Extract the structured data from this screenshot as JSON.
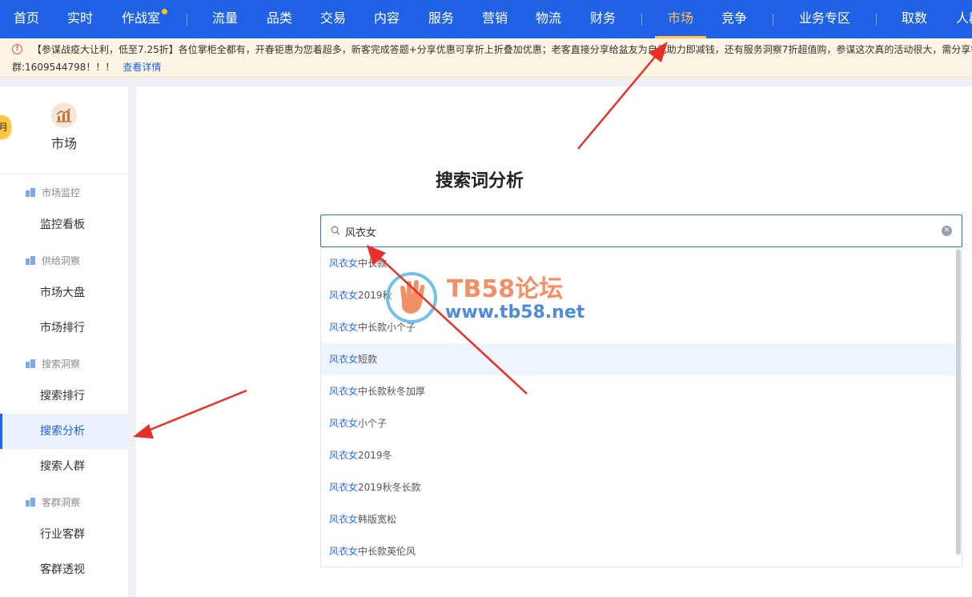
{
  "nav": {
    "items": [
      {
        "label": "首页"
      },
      {
        "label": "实时"
      },
      {
        "label": "作战室"
      },
      {
        "label": "流量"
      },
      {
        "label": "品类"
      },
      {
        "label": "交易"
      },
      {
        "label": "内容"
      },
      {
        "label": "服务"
      },
      {
        "label": "营销"
      },
      {
        "label": "物流"
      },
      {
        "label": "财务"
      },
      {
        "label": "市场"
      },
      {
        "label": "竞争"
      },
      {
        "label": "业务专区"
      },
      {
        "label": "取数"
      },
      {
        "label": "人群"
      }
    ],
    "active": "市场",
    "colors": {
      "bar": "#2062e6",
      "active": "#ffc44d"
    }
  },
  "notice": {
    "line1": "【参谋战疫大让利，低至7.25折】各位掌柜全都有，开春钜惠为您着超多，新客完成答题+分享优惠可享折上折叠加优惠；老客直接分享给盆友为自己助力即减钱，还有服务洞察7折超值购，参谋这次真的活动很大，需分享钉",
    "line2": "群:1609544798！！！",
    "link": "查看详情"
  },
  "sidebar": {
    "tab_label": "月",
    "title": "市场",
    "sections": [
      {
        "label": "市场监控",
        "items": [
          "监控看板"
        ]
      },
      {
        "label": "供给洞察",
        "items": [
          "市场大盘",
          "市场排行"
        ]
      },
      {
        "label": "搜索洞察",
        "items": [
          "搜索排行",
          "搜索分析",
          "搜索人群"
        ]
      },
      {
        "label": "客群洞察",
        "items": [
          "行业客群",
          "客群透视"
        ]
      }
    ],
    "active_item": "搜索分析"
  },
  "main": {
    "title": "搜索词分析",
    "search": {
      "value": "风衣女",
      "icon": "search-icon",
      "clear_icon": "clear-icon"
    },
    "suggestions": [
      {
        "highlight": "风衣女",
        "rest": "中长款"
      },
      {
        "highlight": "风衣女",
        "rest": "2019秋"
      },
      {
        "highlight": "风衣女",
        "rest": "中长款小个子"
      },
      {
        "highlight": "风衣女",
        "rest": "短款"
      },
      {
        "highlight": "风衣女",
        "rest": "中长款秋冬加厚"
      },
      {
        "highlight": "风衣女",
        "rest": "小个子"
      },
      {
        "highlight": "风衣女",
        "rest": "2019冬"
      },
      {
        "highlight": "风衣女",
        "rest": "2019秋冬长款"
      },
      {
        "highlight": "风衣女",
        "rest": "韩版宽松"
      },
      {
        "highlight": "风衣女",
        "rest": "中长款英伦风"
      }
    ],
    "hovered_index": 3
  },
  "watermark": {
    "title": "TB58论坛",
    "url": "www.tb58.net"
  },
  "annotation_color": "#e8302a"
}
